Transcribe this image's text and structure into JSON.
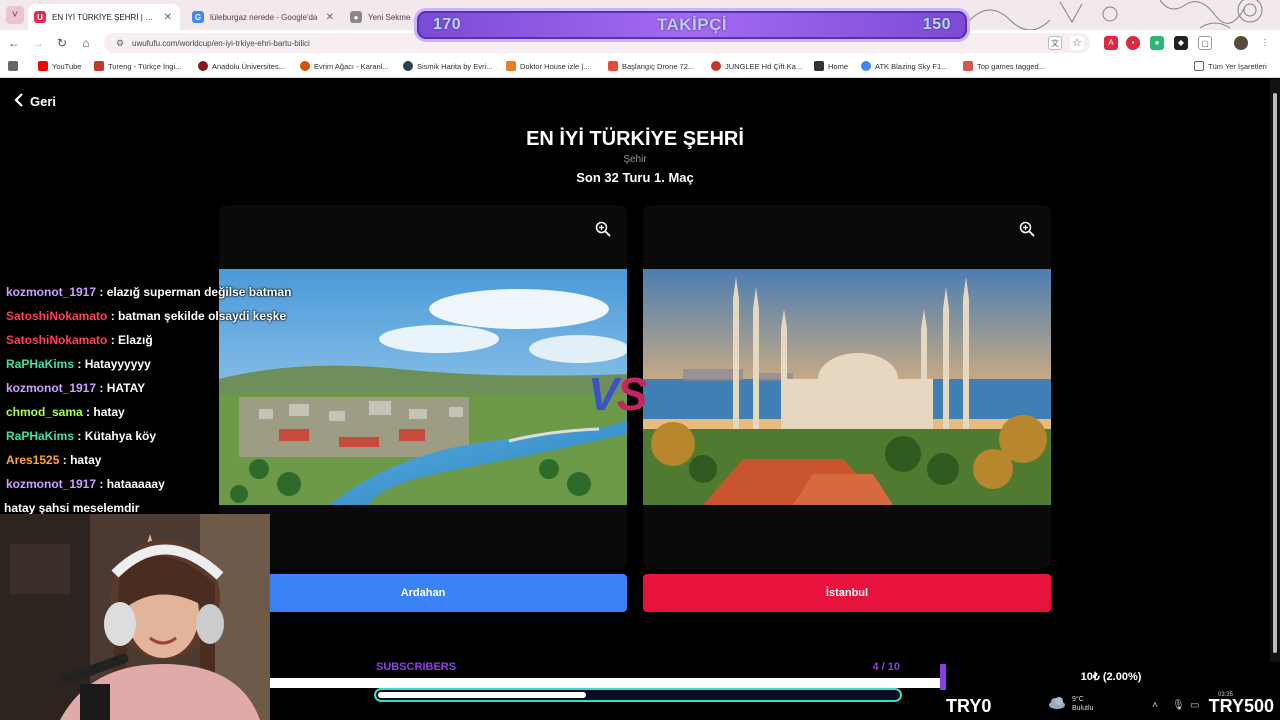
{
  "browser": {
    "tabs": [
      {
        "title": "EN İYİ TÜRKİYE ŞEHRİ | UwUFU",
        "active": true
      },
      {
        "title": "lüleburgaz nerede - Google'da",
        "active": false
      },
      {
        "title": "Yeni Sekme",
        "active": false
      }
    ],
    "url": "uwufufu.com/worldcup/en-iyi-trkiye-ehri-bartu-bilici",
    "bookmarks": [
      "YouTube",
      "Tureng - Türkçe İngi...",
      "Anadolu Üniversites...",
      "Evrim Ağacı - Karanl...",
      "Sismik Harita by Evri...",
      "Doktor House izle |...",
      "Başlangıç Drone 72...",
      "JUNGLEE Hd Çift Ka...",
      "Home",
      "ATK Blazing Sky F1...",
      "Top games tagged..."
    ],
    "all_bookmarks": "Tüm Yer İşaretleri"
  },
  "follower_goal": {
    "left": "170",
    "label": "TAKİPÇİ",
    "right": "150"
  },
  "page": {
    "back": "Geri",
    "title": "EN İYİ TÜRKİYE ŞEHRİ",
    "category": "Şehir",
    "round": "Son 32 Turu 1. Maç",
    "vs": {
      "v": "V",
      "s": "S"
    },
    "left_choice": "Ardahan",
    "right_choice": "İstanbul",
    "colors": {
      "left": "#3b82f6",
      "right": "#e8133c"
    }
  },
  "chat": [
    {
      "user": "kozmonot_1917",
      "color": "#c9a0ff",
      "msg": "elazığ superman değilse batman"
    },
    {
      "user": "SatoshiNokamato",
      "color": "#ff3b5c",
      "msg": "batman şekilde olsaydi keşke"
    },
    {
      "user": "SatoshiNokamato",
      "color": "#ff3b5c",
      "msg": "Elazığ"
    },
    {
      "user": "RaPHaKims",
      "color": "#3fe0a0",
      "msg": "Hatayyyyyy"
    },
    {
      "user": "kozmonot_1917",
      "color": "#c9a0ff",
      "msg": "HATAY"
    },
    {
      "user": "chmod_sama",
      "color": "#aaff44",
      "msg": "hatay"
    },
    {
      "user": "RaPHaKims",
      "color": "#3fe0a0",
      "msg": "Kütahya köy"
    },
    {
      "user": "Ares1525",
      "color": "#ffa52e",
      "msg": "hatay"
    },
    {
      "user": "kozmonot_1917",
      "color": "#c9a0ff",
      "msg": "hataaaaay"
    }
  ],
  "chat_plain": "hatay şahsi meselemdir",
  "subs": {
    "label": "SUBSCRIBERS",
    "count": "4 / 10",
    "progress": 0.4
  },
  "tray": {
    "percent": "10₺ (2.00%)",
    "try0": "TRY0",
    "try500": "TRY500",
    "temp": "9°C",
    "weather": "Bulutlu",
    "time": "03:35"
  }
}
